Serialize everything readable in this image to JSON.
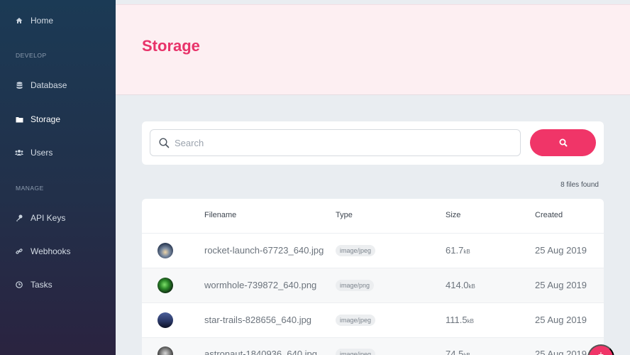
{
  "sidebar": {
    "home": "Home",
    "section_develop": "DEVELOP",
    "database": "Database",
    "storage": "Storage",
    "users": "Users",
    "section_manage": "MANAGE",
    "api_keys": "API Keys",
    "webhooks": "Webhooks",
    "tasks": "Tasks"
  },
  "header": {
    "title": "Storage"
  },
  "search": {
    "placeholder": "Search"
  },
  "files_count": "8 files found",
  "table": {
    "columns": [
      "Filename",
      "Type",
      "Size",
      "Created"
    ],
    "rows": [
      {
        "filename": "rocket-launch-67723_640.jpg",
        "type": "image/jpeg",
        "size": "61.7",
        "unit": "kB",
        "created": "25 Aug 2019"
      },
      {
        "filename": "wormhole-739872_640.png",
        "type": "image/png",
        "size": "414.0",
        "unit": "kB",
        "created": "25 Aug 2019"
      },
      {
        "filename": "star-trails-828656_640.jpg",
        "type": "image/jpeg",
        "size": "111.5",
        "unit": "kB",
        "created": "25 Aug 2019"
      },
      {
        "filename": "astronaut-1840936_640.jpg",
        "type": "image/jpeg",
        "size": "74.5",
        "unit": "kB",
        "created": "25 Aug 2019"
      }
    ]
  },
  "colors": {
    "accent": "#f03568",
    "title": "#e8336a",
    "sidebar_top": "#1b3a55",
    "sidebar_bottom": "#2a2340"
  },
  "icons": {
    "home": "home-icon",
    "database": "database-icon",
    "storage": "folder-icon",
    "users": "users-icon",
    "api_keys": "key-icon",
    "webhooks": "link-icon",
    "tasks": "clock-icon",
    "search": "search-icon",
    "fab": "plus-icon"
  }
}
